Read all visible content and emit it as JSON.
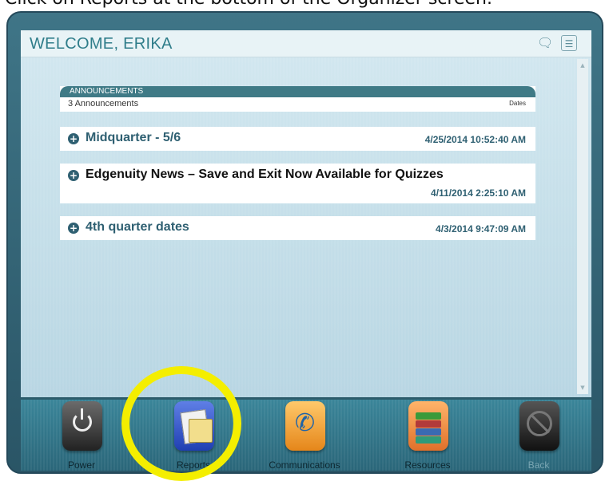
{
  "caption": "Click on Reports at the bottom of the Organizer screen.",
  "header": {
    "welcome": "WELCOME, ERIKA",
    "chat_icon": "chat-bubble-icon",
    "settings_icon": "sliders-icon"
  },
  "announcements": {
    "title": "ANNOUNCEMENTS",
    "count": "3 Announcements",
    "dates_label": "Dates",
    "items": [
      {
        "title": "Midquarter - 5/6",
        "date": "4/25/2014 10:52:40 AM"
      },
      {
        "title": "Edgenuity News – Save and Exit Now Available for Quizzes",
        "date": "4/11/2014 2:25:10 AM"
      },
      {
        "title": "4th quarter dates",
        "date": "4/3/2014 9:47:09 AM"
      }
    ]
  },
  "dock": {
    "power": "Power",
    "reports": "Reports",
    "communications": "Communications",
    "resources": "Resources",
    "back": "Back"
  },
  "colors": {
    "accent_teal": "#2f7d8a",
    "highlight": "#f4ee00",
    "dock": "#2a6679"
  }
}
